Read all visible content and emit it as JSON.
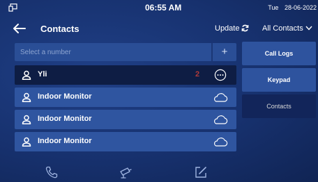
{
  "status": {
    "time": "06:55 AM",
    "day": "Tue",
    "date": "28-06-2022"
  },
  "header": {
    "title": "Contacts",
    "update_label": "Update",
    "filter_label": "All Contacts"
  },
  "search": {
    "placeholder": "Select a number",
    "add_symbol": "+"
  },
  "contacts": [
    {
      "name": "Yli",
      "selected": true,
      "badge": "2",
      "action_icon": "more-icon"
    },
    {
      "name": "Indoor Monitor",
      "selected": false,
      "action_icon": "cloud-icon"
    },
    {
      "name": "Indoor Monitor",
      "selected": false,
      "action_icon": "cloud-icon"
    },
    {
      "name": "Indoor Monitor",
      "selected": false,
      "action_icon": "cloud-icon"
    }
  ],
  "side_menu": [
    {
      "label": "Call Logs",
      "active": false
    },
    {
      "label": "Keypad",
      "active": false
    },
    {
      "label": "Contacts",
      "active": true
    }
  ],
  "bottom_icons": [
    "phone-icon",
    "camera-icon",
    "edit-icon"
  ],
  "colors": {
    "background": "#17316e",
    "row": "#2f55a0",
    "selected_row": "#0e1d44",
    "accent": "#ffffff"
  }
}
